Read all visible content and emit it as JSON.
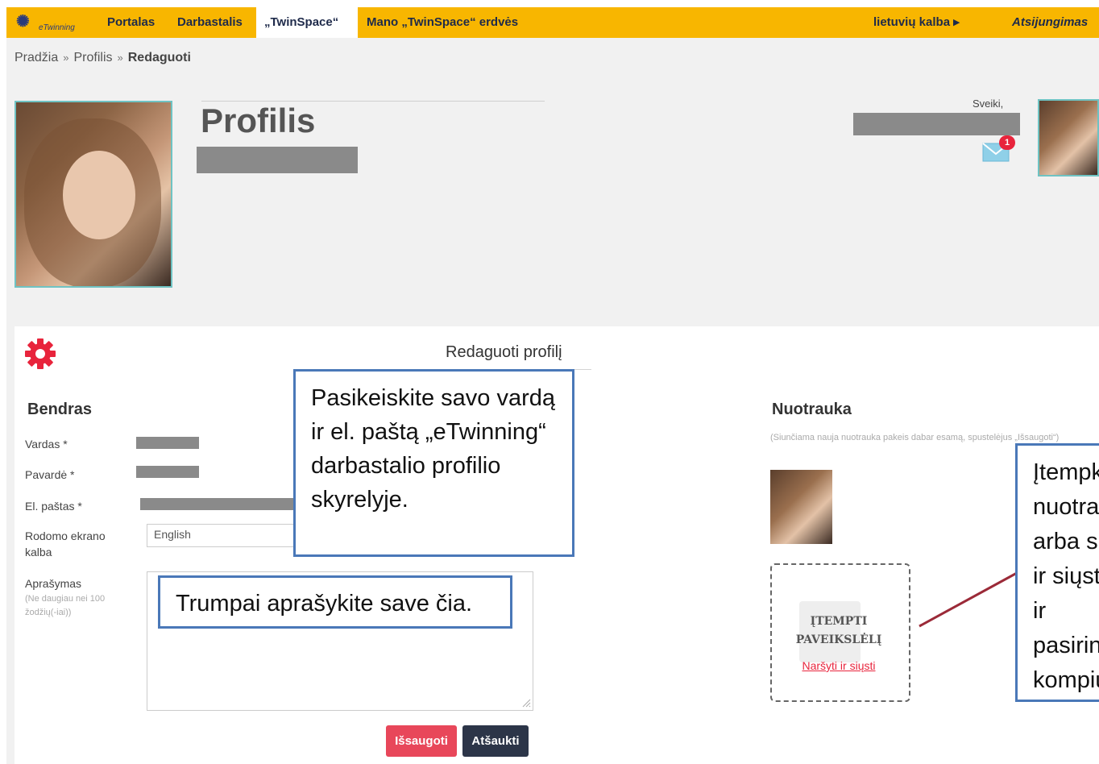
{
  "nav": {
    "logo_text": "eTwinning",
    "items": [
      {
        "label": "Portalas"
      },
      {
        "label": "Darbastalis"
      },
      {
        "label": "„TwinSpace“"
      },
      {
        "label": "Mano „TwinSpace“ erdvės"
      }
    ],
    "active_index": 2,
    "language": "lietuvių kalba ▸",
    "logout": "Atsijungimas"
  },
  "breadcrumb": {
    "items": [
      "Pradžia",
      "Profilis",
      "Redaguoti"
    ],
    "separator": "»"
  },
  "profile": {
    "title": "Profilis",
    "greeting": "Sveiki,",
    "unread_messages": "1"
  },
  "edit_card": {
    "heading": "Redaguoti profilį",
    "general": {
      "title": "Bendras",
      "first_name_label": "Vardas *",
      "last_name_label": "Pavardė *",
      "email_label": "El. paštas *",
      "display_language_label": "Rodomo ekrano kalba",
      "display_language_value": "English",
      "description_label": "Aprašymas",
      "description_hint": "(Ne daugiau nei 100 žodžių(-iai))"
    },
    "photo": {
      "title": "Nuotrauka",
      "note": "(Siunčiama nauja nuotrauka pakeis dabar esamą, spustelėjus „Išsaugoti“)",
      "drop_label": "ĮTEMPTI PAVEIKSLĖLĮ",
      "browse_link": "Naršyti ir siųsti"
    },
    "save_button": "Išsaugoti",
    "cancel_button": "Atšaukti"
  },
  "callouts": {
    "name_email": "Pasikeiskite savo vardą ir el. paštą „eTwinning“ darbastalio profilio skyrelyje.",
    "description": "Trumpai aprašykite save čia.",
    "photo": "Įtempkite nuotrauką arba spauskite „Naršyti ir siųsti“ ir pasirinkite ją savo kompiuteryje ar įrenginyje."
  },
  "colors": {
    "topbar": "#f8b600",
    "accent_red": "#e8243c",
    "callout_border": "#4a78b8",
    "avatar_border": "#6fc3c3",
    "cancel_dark": "#2c3548"
  }
}
